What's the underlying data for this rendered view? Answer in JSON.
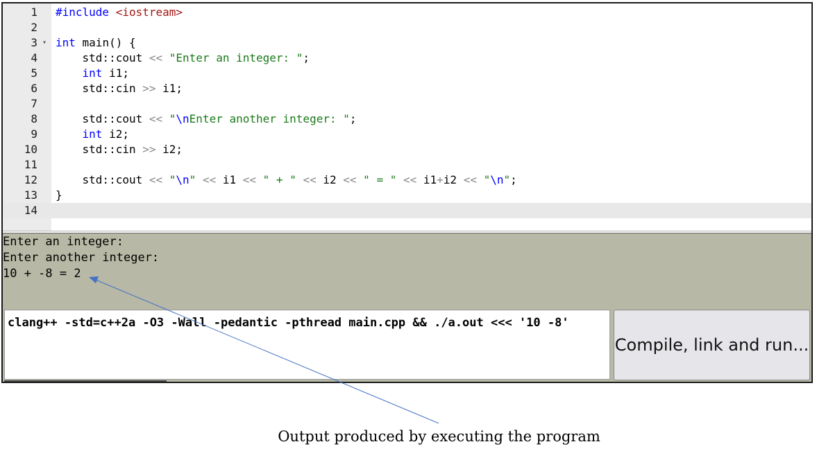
{
  "editor": {
    "lines": [
      {
        "num": "1"
      },
      {
        "num": "2"
      },
      {
        "num": "3",
        "fold": "▾"
      },
      {
        "num": "4"
      },
      {
        "num": "5"
      },
      {
        "num": "6"
      },
      {
        "num": "7"
      },
      {
        "num": "8"
      },
      {
        "num": "9"
      },
      {
        "num": "10"
      },
      {
        "num": "11"
      },
      {
        "num": "12"
      },
      {
        "num": "13"
      },
      {
        "num": "14"
      }
    ],
    "tokens": {
      "l1_a": "#include ",
      "l1_b": "<iostream>",
      "l3_a": "int",
      "l3_b": " main() {",
      "l4_a": "    std::cout ",
      "l4_b": "<<",
      "l4_c": " ",
      "l4_d": "\"Enter an integer: \"",
      "l4_e": ";",
      "l5_a": "    ",
      "l5_b": "int",
      "l5_c": " i1;",
      "l6_a": "    std::cin ",
      "l6_b": ">>",
      "l6_c": " i1;",
      "l8_a": "    std::cout ",
      "l8_b": "<<",
      "l8_c": " ",
      "l8_d": "\"",
      "l8_e": "\\n",
      "l8_f": "Enter another integer: \"",
      "l8_g": ";",
      "l9_a": "    ",
      "l9_b": "int",
      "l9_c": " i2;",
      "l10_a": "    std::cin ",
      "l10_b": ">>",
      "l10_c": " i2;",
      "l12_a": "    std::cout ",
      "l12_b": "<<",
      "l12_c": " ",
      "l12_d": "\"",
      "l12_e": "\\n",
      "l12_f": "\"",
      "l12_g": " ",
      "l12_h": "<<",
      "l12_i": " i1 ",
      "l12_j": "<<",
      "l12_k": " ",
      "l12_l": "\" + \"",
      "l12_m": " ",
      "l12_n": "<<",
      "l12_o": " i2 ",
      "l12_p": "<<",
      "l12_q": " ",
      "l12_r": "\" = \"",
      "l12_s": " ",
      "l12_t": "<<",
      "l12_u": " i1",
      "l12_v": "+",
      "l12_w": "i2 ",
      "l12_x": "<<",
      "l12_y": " ",
      "l12_z": "\"",
      "l12_aa": "\\n",
      "l12_ab": "\"",
      "l12_ac": ";",
      "l13_a": "}"
    }
  },
  "output": {
    "lines": [
      "Enter an integer:",
      "Enter another integer:",
      "10 + -8 = 2"
    ]
  },
  "command": {
    "text": "clang++ -std=c++2a -O3 -Wall -pedantic -pthread main.cpp && ./a.out <<< '10 -8'"
  },
  "run_button": {
    "label": "Compile, link and run..."
  },
  "annotation": {
    "caption": "Output produced by executing the program"
  },
  "colors": {
    "keyword": "#0000ff",
    "string": "#1a7a1a",
    "include": "#a31515",
    "output_bg": "#b8b8a6",
    "gutter_bg": "#ebebeb"
  }
}
